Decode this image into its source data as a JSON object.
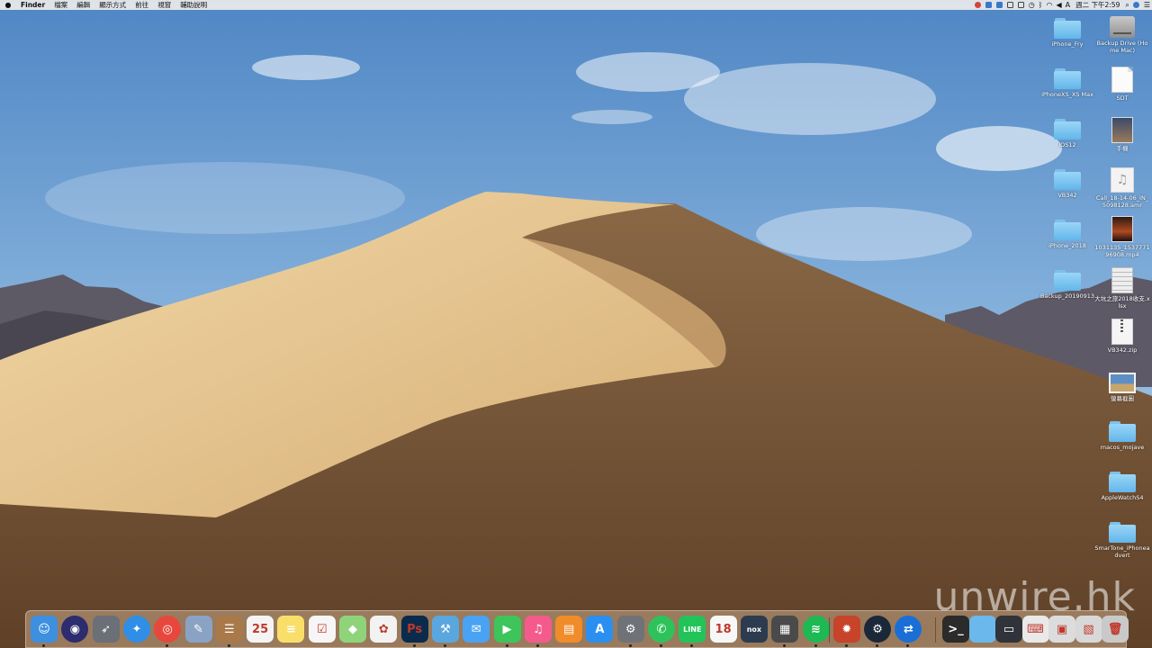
{
  "menubar": {
    "apple_icon": "apple-icon",
    "items": [
      "Finder",
      "檔案",
      "編輯",
      "顯示方式",
      "前往",
      "視窗",
      "輔助說明"
    ],
    "clock": "週二 下午2:59",
    "status_icons": [
      "record-icon",
      "dropbox-icon",
      "teamviewer-icon",
      "clipboard-icon",
      "screen-icon",
      "time-machine-icon",
      "bluetooth-icon",
      "wifi-icon",
      "volume-icon",
      "input-source-icon",
      "search-icon",
      "siri-icon",
      "notification-icon"
    ],
    "input_source": "A"
  },
  "desktop": {
    "icons": [
      {
        "label": "iPhone_Fry",
        "type": "folder"
      },
      {
        "label": "Backup Drive (Home Mac)",
        "type": "hdd"
      },
      {
        "label": "iPhoneXS_XS Max",
        "type": "folder"
      },
      {
        "label": "SDT",
        "type": "doc"
      },
      {
        "label": "iOS12",
        "type": "folder"
      },
      {
        "label": "手機",
        "type": "thumb"
      },
      {
        "label": "VB342",
        "type": "folder"
      },
      {
        "label": "Call_18-14-06_IN_5098128.amr",
        "type": "music"
      },
      {
        "label": "iPhone_2018",
        "type": "folder"
      },
      {
        "label": "1031135_1537771 96908.mp4",
        "type": "video"
      },
      {
        "label": "Backup_20190913",
        "type": "folder"
      },
      {
        "label": "大坑之旅2018收支.xlsx",
        "type": "sheet"
      },
      {
        "label": "VB342.zip",
        "type": "zip"
      },
      {
        "label": "螢幕截圖",
        "type": "screenshot"
      },
      {
        "label": "macos_mojave",
        "type": "folder"
      },
      {
        "label": "AppleWatchS4",
        "type": "folder"
      },
      {
        "label": "SmarTone_iPhonea dvert",
        "type": "folder"
      }
    ]
  },
  "watermark": "unwire.hk",
  "dock": {
    "apps": [
      {
        "name": "finder-icon",
        "color": "#3d8fe0",
        "glyph": "☺"
      },
      {
        "name": "siri-icon",
        "color": "#2c2c6e",
        "glyph": "◉"
      },
      {
        "name": "launchpad-icon",
        "color": "#6b6f78",
        "glyph": "➶"
      },
      {
        "name": "safari-icon",
        "color": "#2f8ee6",
        "glyph": "✦"
      },
      {
        "name": "chrome-icon",
        "color": "#e8473d",
        "glyph": "◎"
      },
      {
        "name": "preview-icon",
        "color": "#8aa3c4",
        "glyph": "✎"
      },
      {
        "name": "contacts-icon",
        "color": "#a9794a",
        "glyph": "☰"
      },
      {
        "name": "calendar-icon",
        "color": "#f4f4f4",
        "glyph": "25"
      },
      {
        "name": "notes-icon",
        "color": "#f9df6a",
        "glyph": "≡"
      },
      {
        "name": "reminders-icon",
        "color": "#f6f6f6",
        "glyph": "☑"
      },
      {
        "name": "maps-icon",
        "color": "#8fd47a",
        "glyph": "◆"
      },
      {
        "name": "photos-icon",
        "color": "#f2f2f2",
        "glyph": "✿"
      },
      {
        "name": "photoshop-icon",
        "color": "#0b2b4c",
        "glyph": "Ps"
      },
      {
        "name": "xcode-icon",
        "color": "#5aa7df",
        "glyph": "⚒"
      },
      {
        "name": "messages-icon",
        "color": "#4aa3f2",
        "glyph": "✉"
      },
      {
        "name": "facetime-icon",
        "color": "#3dc45b",
        "glyph": "▶"
      },
      {
        "name": "itunes-icon",
        "color": "#f45b8c",
        "glyph": "♫"
      },
      {
        "name": "books-icon",
        "color": "#f08c2a",
        "glyph": "▤"
      },
      {
        "name": "app-store-icon",
        "color": "#2a8ff0",
        "glyph": "A"
      },
      {
        "name": "system-preferences-icon",
        "color": "#6f7378",
        "glyph": "⚙"
      },
      {
        "name": "whatsapp-icon",
        "color": "#2ec35a",
        "glyph": "✆"
      },
      {
        "name": "line-icon",
        "color": "#22c45a",
        "glyph": "LINE"
      },
      {
        "name": "game18-icon",
        "color": "#f7f7f7",
        "glyph": "18"
      },
      {
        "name": "nox-icon",
        "color": "#2d3b4f",
        "glyph": "nox"
      },
      {
        "name": "calculator-icon",
        "color": "#4a4a4a",
        "glyph": "▦"
      },
      {
        "name": "spotify-icon",
        "color": "#1db954",
        "glyph": "≋"
      },
      {
        "name": "firewall-icon",
        "color": "#c7432a",
        "glyph": "✹"
      },
      {
        "name": "steam-icon",
        "color": "#1b2838",
        "glyph": "⚙"
      },
      {
        "name": "teamviewer-icon",
        "color": "#1a6fd6",
        "glyph": "⇄"
      }
    ],
    "stacks": [
      {
        "name": "terminal-stack-icon",
        "color": "#2b2b2b",
        "glyph": ">_"
      },
      {
        "name": "folder-stack-icon",
        "color": "#6bb8ec",
        "glyph": ""
      },
      {
        "name": "window-stack-icon",
        "color": "#30343a",
        "glyph": "▭"
      },
      {
        "name": "keyboard-viewer-icon",
        "color": "#e9e9e9",
        "glyph": "⌨"
      },
      {
        "name": "downloads-stack-icon",
        "color": "#dcdcdc",
        "glyph": "▣"
      },
      {
        "name": "photo-stack-icon",
        "color": "#d8d8d8",
        "glyph": "▧"
      },
      {
        "name": "trash-icon",
        "color": "#c9c9c9",
        "glyph": "🗑"
      }
    ]
  }
}
